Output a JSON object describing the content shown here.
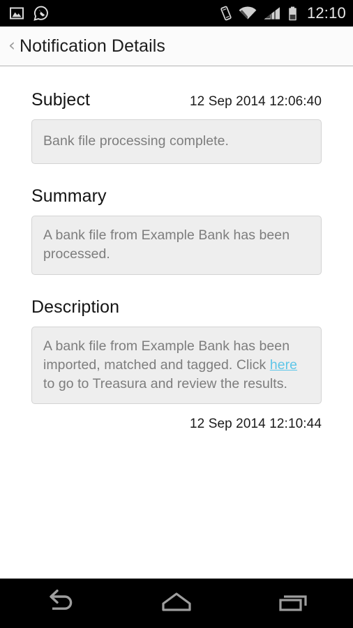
{
  "status_bar": {
    "left_icons": [
      {
        "name": "gallery-icon",
        "label": "Gallery notification"
      },
      {
        "name": "whatsapp-icon",
        "label": "WhatsApp notification"
      }
    ],
    "right_icons": [
      {
        "name": "vibrate-icon",
        "label": "Vibrate mode"
      },
      {
        "name": "wifi-icon",
        "label": "Wi-Fi signal"
      },
      {
        "name": "cellular-signal-icon",
        "label": "Cellular signal"
      },
      {
        "name": "battery-icon",
        "label": "Battery"
      }
    ],
    "clock": "12:10",
    "background_color": "#000000",
    "text_color": "#e8e8e8"
  },
  "action_bar": {
    "back_chevron": "‹",
    "title": "Notification Details"
  },
  "content": {
    "subject": {
      "label": "Subject",
      "timestamp": "12 Sep 2014 12:06:40",
      "value": "Bank file processing complete."
    },
    "summary": {
      "label": "Summary",
      "value": "A bank file from Example Bank has been processed."
    },
    "description": {
      "label": "Description",
      "text_before_link": "A bank file from Example Bank has been imported, matched and tagged. Click ",
      "link_text": "here",
      "text_after_link": " to go to Treasura and review the results."
    },
    "footer_timestamp": "12 Sep 2014 12:10:44"
  },
  "nav_bar": {
    "buttons": [
      {
        "name": "back-button",
        "label": "Back"
      },
      {
        "name": "home-button",
        "label": "Home"
      },
      {
        "name": "recent-apps-button",
        "label": "Recent apps"
      }
    ]
  },
  "colors": {
    "link": "#5ec6e8",
    "field_box_background": "#eeeeee",
    "field_box_border": "#d3d3d3",
    "field_text": "#7d7d7d",
    "page_background": "#ffffff"
  }
}
